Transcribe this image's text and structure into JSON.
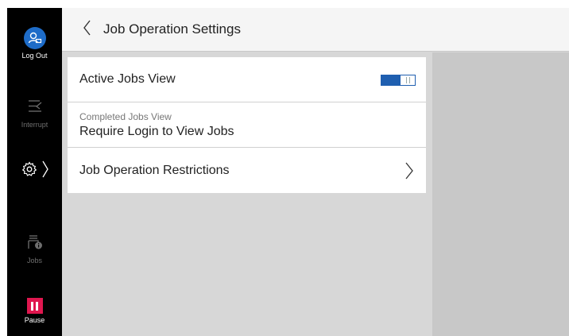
{
  "rail": {
    "logout_label": "Log Out",
    "interrupt_label": "Interrupt",
    "jobs_label": "Jobs",
    "pause_label": "Pause",
    "icons": {
      "logout": "user-logout-icon",
      "interrupt": "interrupt-icon",
      "settings": "gear-icon",
      "jobs": "jobs-info-icon",
      "pause": "pause-icon"
    }
  },
  "header": {
    "title": "Job Operation Settings"
  },
  "settings": {
    "active_jobs_view": {
      "label": "Active Jobs View",
      "toggle_state": "on"
    },
    "completed_jobs_view": {
      "label": "Completed Jobs View",
      "value": "Require Login to View Jobs"
    },
    "job_operation_restrictions": {
      "label": "Job Operation Restrictions"
    }
  },
  "colors": {
    "accent": "#1f5fb0",
    "logout_circle": "#1e6cc8",
    "pause": "#e0174f",
    "rail": "#000000",
    "background": "#d7d7d7"
  }
}
